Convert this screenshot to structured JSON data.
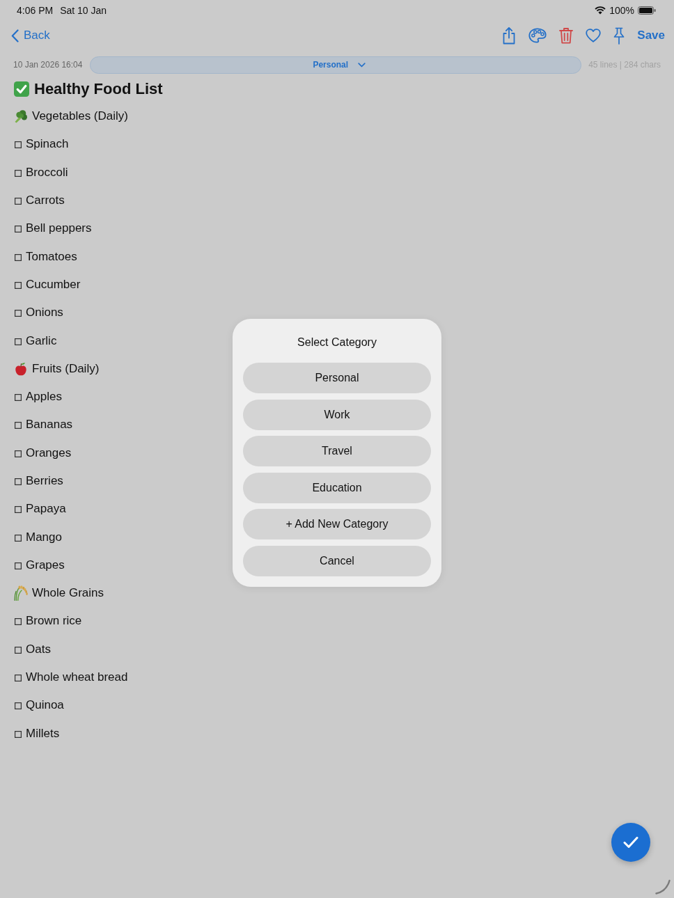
{
  "status_bar": {
    "time": "4:06 PM",
    "date": "Sat 10 Jan",
    "battery": "100%"
  },
  "nav": {
    "back": "Back",
    "save": "Save"
  },
  "meta": {
    "timestamp": "10 Jan 2026 16:04",
    "category": "Personal",
    "stats": "45 lines | 284 chars"
  },
  "note": {
    "title": "Healthy Food List",
    "sections": [
      {
        "heading": "Vegetables (Daily)",
        "items": [
          {
            "text": "Spinach",
            "checked": false
          },
          {
            "text": "Broccoli",
            "checked": false
          },
          {
            "text": "Carrots",
            "checked": false
          },
          {
            "text": "Bell peppers",
            "checked": false
          },
          {
            "text": "Tomatoes",
            "checked": false
          },
          {
            "text": "Cucumber",
            "checked": false
          },
          {
            "text": "Onions",
            "checked": false
          },
          {
            "text": "Garlic",
            "checked": false
          }
        ]
      },
      {
        "heading": "Fruits (Daily)",
        "items": [
          {
            "text": "Apples",
            "checked": false
          },
          {
            "text": "Bananas",
            "checked": false
          },
          {
            "text": "Oranges",
            "checked": false
          },
          {
            "text": "Berries",
            "checked": false
          },
          {
            "text": "Papaya",
            "checked": false
          },
          {
            "text": "Mango",
            "checked": false
          },
          {
            "text": "Grapes",
            "checked": false
          }
        ]
      },
      {
        "heading": "Whole Grains",
        "items": [
          {
            "text": "Brown rice",
            "checked": false
          },
          {
            "text": "Oats",
            "checked": false
          },
          {
            "text": "Whole wheat bread",
            "checked": false
          },
          {
            "text": "Quinoa",
            "checked": false
          },
          {
            "text": "Millets",
            "checked": false
          }
        ]
      }
    ]
  },
  "dialog": {
    "title": "Select Category",
    "options": [
      "Personal",
      "Work",
      "Travel",
      "Education",
      "+ Add New Category",
      "Cancel"
    ]
  }
}
